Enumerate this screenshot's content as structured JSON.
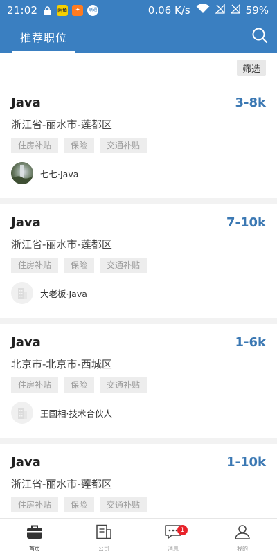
{
  "status_bar": {
    "time": "21:02",
    "network_speed": "0.06 K/s",
    "battery": "59%",
    "app_icons": [
      "lock-icon",
      "app-icon-yellow",
      "app-icon-orange",
      "app-icon-white"
    ],
    "icon_labels": {
      "yellow": "闲鱼",
      "white": "联通"
    }
  },
  "header": {
    "tab_label": "推荐职位",
    "search_icon": "search-icon",
    "background": "#3a7fc1"
  },
  "filter": {
    "label": "筛选"
  },
  "jobs": [
    {
      "title": "Java",
      "salary": "3-8k",
      "location": "浙江省-丽水市-莲都区",
      "tags": [
        "住房补贴",
        "保险",
        "交通补贴"
      ],
      "recruiter": "七七·Java",
      "avatar": "photo"
    },
    {
      "title": "Java",
      "salary": "7-10k",
      "location": "浙江省-丽水市-莲都区",
      "tags": [
        "住房补贴",
        "保险",
        "交通补贴"
      ],
      "recruiter": "大老板·Java",
      "avatar": "default"
    },
    {
      "title": "Java",
      "salary": "1-6k",
      "location": "北京市-北京市-西城区",
      "tags": [
        "住房补贴",
        "保险",
        "交通补贴"
      ],
      "recruiter": "王国相·技术合伙人",
      "avatar": "default"
    },
    {
      "title": "Java",
      "salary": "1-10k",
      "location": "浙江省-丽水市-莲都区",
      "tags": [
        "住房补贴",
        "保险",
        "交通补贴"
      ],
      "recruiter": "",
      "avatar": "default"
    }
  ],
  "bottom_nav": [
    {
      "label": "首页",
      "icon": "briefcase-icon",
      "active": true
    },
    {
      "label": "公司",
      "icon": "company-icon",
      "active": false
    },
    {
      "label": "消息",
      "icon": "message-icon",
      "active": false,
      "badge": "1"
    },
    {
      "label": "我的",
      "icon": "user-icon",
      "active": false
    }
  ],
  "colors": {
    "primary": "#3a7fc1",
    "salary": "#3b78b3",
    "badge": "#e8222a"
  }
}
